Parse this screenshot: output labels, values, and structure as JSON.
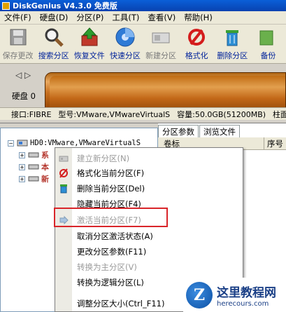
{
  "title": "DiskGenius V4.3.0 免费版",
  "menu": [
    "文件(F)",
    "硬盘(D)",
    "分区(P)",
    "工具(T)",
    "查看(V)",
    "帮助(H)"
  ],
  "toolbar": [
    {
      "label": "保存更改",
      "icon": "save-icon",
      "enabled": false
    },
    {
      "label": "搜索分区",
      "icon": "magnifier-icon",
      "enabled": true
    },
    {
      "label": "恢复文件",
      "icon": "recover-icon",
      "enabled": true
    },
    {
      "label": "快速分区",
      "icon": "quick-partition-icon",
      "enabled": true
    },
    {
      "label": "新建分区",
      "icon": "new-partition-icon",
      "enabled": false
    },
    {
      "label": "格式化",
      "icon": "format-icon",
      "enabled": true
    },
    {
      "label": "删除分区",
      "icon": "delete-icon",
      "enabled": true
    },
    {
      "label": "备份",
      "icon": "backup-icon",
      "enabled": true
    }
  ],
  "disk": {
    "label": "硬盘 0",
    "info": {
      "interface": "接口:FIBRE",
      "model": "型号:VMware,VMwareVirtualS",
      "capacity": "容量:50.0GB(51200MB)",
      "cylinder": "柱面"
    }
  },
  "tree": {
    "root": "HD0:VMware,VMwareVirtualS",
    "children": [
      "系",
      "本",
      "新"
    ]
  },
  "tabs": [
    "分区参数",
    "浏览文件"
  ],
  "columns": [
    "卷标",
    "序号"
  ],
  "context_menu": [
    {
      "label": "建立新分区(N)",
      "icon": "new-partition-icon",
      "enabled": false
    },
    {
      "label": "格式化当前分区(F)",
      "icon": "format-icon",
      "enabled": true
    },
    {
      "label": "删除当前分区(Del)",
      "icon": "trash-icon",
      "enabled": true
    },
    {
      "label": "隐藏当前分区(F4)",
      "icon": "",
      "enabled": true
    },
    {
      "label": "激活当前分区(F7)",
      "icon": "activate-icon",
      "enabled": false
    },
    {
      "label": "取消分区激活状态(A)",
      "icon": "",
      "enabled": true
    },
    {
      "label": "更改分区参数(F11)",
      "icon": "",
      "enabled": true
    },
    {
      "label": "转换为主分区(V)",
      "icon": "",
      "enabled": false
    },
    {
      "label": "转换为逻辑分区(L)",
      "icon": "",
      "enabled": true
    },
    {
      "label": "调整分区大小(Ctrl_F11)",
      "icon": "",
      "enabled": true
    }
  ],
  "watermark": {
    "name": "这里教程网",
    "url": "herecours.com"
  }
}
